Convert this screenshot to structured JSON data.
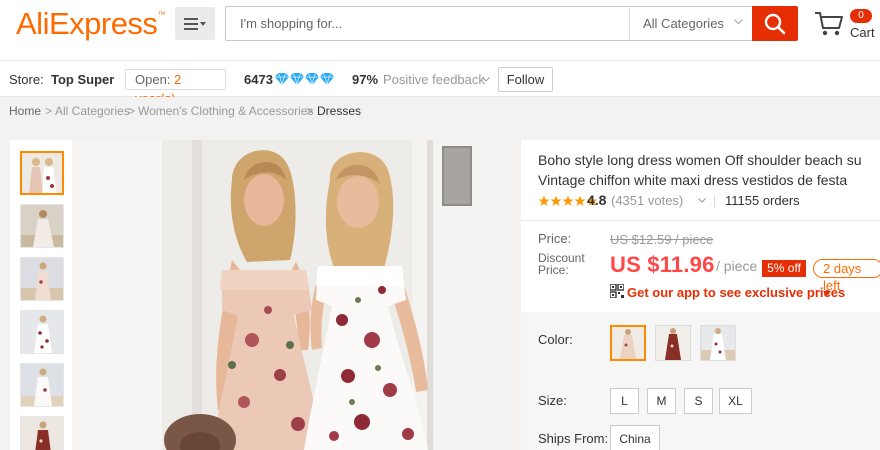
{
  "header": {
    "logo": "AliExpress",
    "logo_tm": "™",
    "search_placeholder": "I'm shopping for...",
    "category": "All Categories",
    "cart_count": "0",
    "cart_label": "Cart"
  },
  "store": {
    "label": "Store:",
    "name": "Top Super",
    "open_prefix": "Open:",
    "open_years": "2 year(s)",
    "score": "6473",
    "diamond_count": 4,
    "feedback_pct": "97%",
    "feedback_label": "Positive feedback",
    "follow_label": "Follow"
  },
  "breadcrumb": [
    "Home",
    ">",
    "All Categories",
    ">",
    "Women's Clothing & Accessories",
    ">",
    "Dresses"
  ],
  "product": {
    "title_line1": "Boho style long dress women Off shoulder beach su",
    "title_line2": "Vintage chiffon white maxi dress vestidos de festa",
    "rating": "4.8",
    "votes": "(4351 votes)",
    "orders": "11155 orders",
    "price_label": "Price:",
    "old_price": "US $12.59 / piece",
    "discount_label": "Discount Price:",
    "new_price": "US $11.96",
    "per_unit": "/ piece",
    "off_badge": "5% off",
    "days_left": "2 days left",
    "app_promo": "Get our app to see exclusive prices",
    "color_label": "Color:",
    "size_label": "Size:",
    "sizes": [
      "L",
      "M",
      "S",
      "XL"
    ],
    "ships_label": "Ships From:",
    "ships_value": "China"
  },
  "colors": {
    "accent": "#ff6a00",
    "red": "#e62e04",
    "price": "#ff4747",
    "diamond": "#2aa7f2",
    "star": "#ff9900"
  }
}
